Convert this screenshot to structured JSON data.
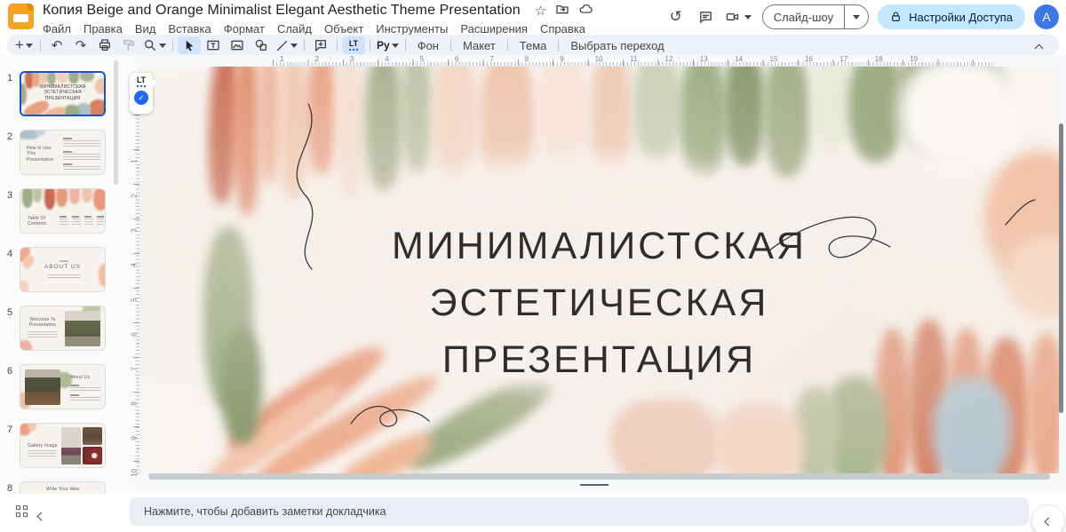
{
  "header": {
    "title": "Копия Beige and Orange Minimalist Elegant Aesthetic Theme Presentation",
    "menu": [
      "Файл",
      "Правка",
      "Вид",
      "Вставка",
      "Формат",
      "Слайд",
      "Объект",
      "Инструменты",
      "Расширения",
      "Справка"
    ],
    "slideshow_label": "Слайд-шоу",
    "share_label": "Настройки Доступа",
    "avatar": "A"
  },
  "toolbar": {
    "font_tool": "Pу",
    "background_label": "Фон",
    "layout_label": "Макет",
    "theme_label": "Тема",
    "transition_label": "Выбрать переход",
    "lt_label": "LT"
  },
  "lt": {
    "label": "LT",
    "check": "✓"
  },
  "filmstrip": {
    "slides": [
      {
        "num": "1",
        "lines": [
          "МИНИМАЛИСТСКАЯ",
          "ЭСТЕТИЧЕСКАЯ",
          "ПРЕЗЕНТАЦИЯ"
        ]
      },
      {
        "num": "2",
        "title": "How to Use This Presentation"
      },
      {
        "num": "3",
        "title_line1": "Table Of",
        "title_line2": "Contents"
      },
      {
        "num": "4",
        "title": "ABOUT US"
      },
      {
        "num": "5",
        "title_line1": "Welcome To",
        "title_line2": "Presentation"
      },
      {
        "num": "6",
        "title": "About Us"
      },
      {
        "num": "7",
        "title": "Gallery Image"
      },
      {
        "num": "8",
        "title": "Write Your Idea"
      }
    ]
  },
  "canvas": {
    "ruler_h": [
      1,
      2,
      3,
      4,
      5,
      6,
      7,
      8,
      9,
      10,
      11,
      12,
      13,
      14,
      15,
      16,
      17,
      18,
      19
    ],
    "ruler_v": [
      1,
      2,
      3,
      4,
      5,
      6,
      7,
      8,
      9,
      10
    ]
  },
  "slide": {
    "title_lines": [
      "МИНИМАЛИСТСКАЯ",
      "ЭСТЕТИЧЕСКАЯ",
      "ПРЕЗЕНТАЦИЯ"
    ]
  },
  "notes": {
    "placeholder": "Нажмите, чтобы добавить заметки докладчика"
  },
  "colors": {
    "selection_blue": "#0b57d0",
    "share_pill": "#c2e7ff",
    "toolbar_bg": "#edf2fa",
    "notes_bg": "#e9eef6",
    "terracotta": "#c96b50",
    "salmon": "#e49a7d",
    "peach": "#f0c9b2",
    "sage": "#a3ad8a",
    "blue_gray": "#a9c0cd"
  }
}
